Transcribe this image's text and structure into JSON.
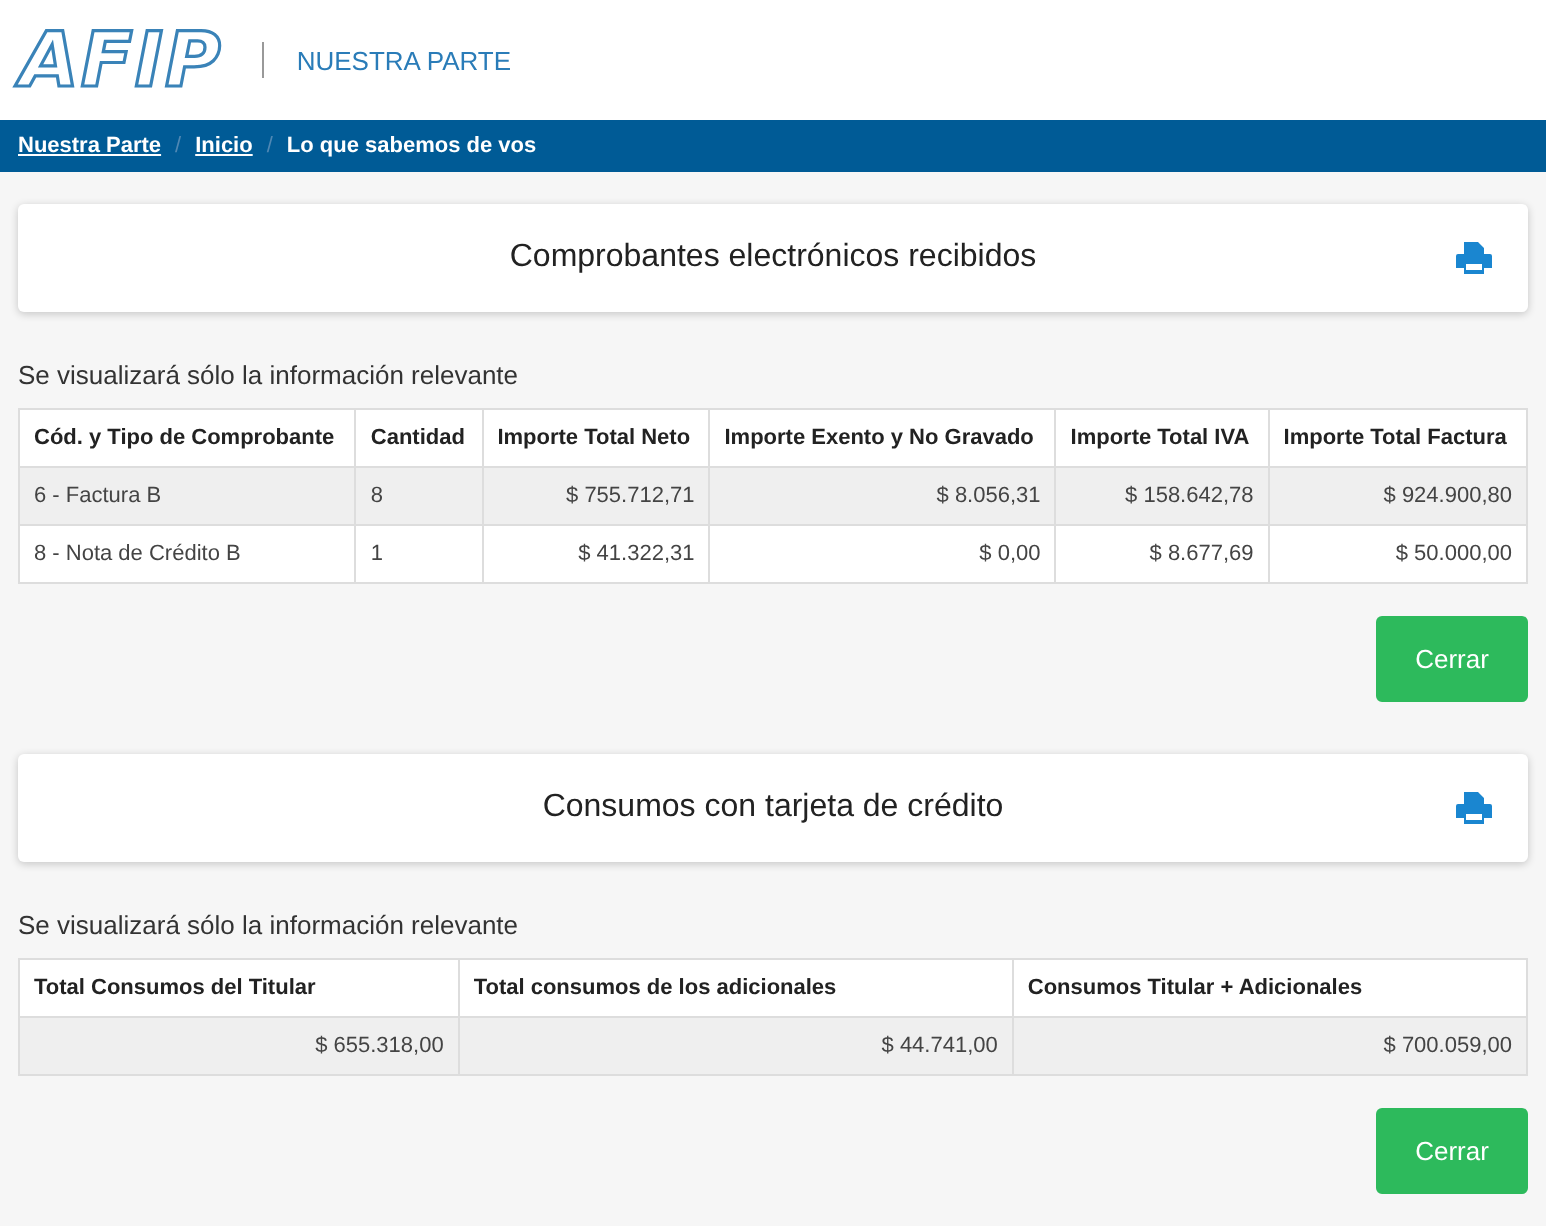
{
  "header": {
    "logo": "AFIP",
    "title": "NUESTRA PARTE"
  },
  "breadcrumb_separator": "/",
  "breadcrumb": [
    {
      "label": "Nuestra Parte",
      "link": true
    },
    {
      "label": "Inicio",
      "link": true
    },
    {
      "label": "Lo que sabemos de vos",
      "link": false
    }
  ],
  "sections": [
    {
      "title": "Comprobantes electrónicos recibidos",
      "note": "Se visualizará sólo la información relevante",
      "columns": [
        {
          "label": "Cód. y Tipo de Comprobante",
          "kind": "text"
        },
        {
          "label": "Cantidad",
          "kind": "text"
        },
        {
          "label": "Importe Total Neto",
          "kind": "amount"
        },
        {
          "label": "Importe Exento y No Gravado",
          "kind": "amount"
        },
        {
          "label": "Importe Total IVA",
          "kind": "amount"
        },
        {
          "label": "Importe Total Factura",
          "kind": "amount"
        }
      ],
      "rows": [
        [
          "6 - Factura B",
          "8",
          "$ 755.712,71",
          "$ 8.056,31",
          "$ 158.642,78",
          "$ 924.900,80"
        ],
        [
          "8 - Nota de Crédito B",
          "1",
          "$ 41.322,31",
          "$ 0,00",
          "$ 8.677,69",
          "$ 50.000,00"
        ]
      ],
      "button": "Cerrar"
    },
    {
      "title": "Consumos con tarjeta de crédito",
      "note": "Se visualizará sólo la información relevante",
      "columns": [
        {
          "label": "Total Consumos del Titular",
          "kind": "amount"
        },
        {
          "label": "Total consumos de los adicionales",
          "kind": "amount"
        },
        {
          "label": "Consumos Titular + Adicionales",
          "kind": "amount"
        }
      ],
      "rows": [
        [
          "$ 655.318,00",
          "$ 44.741,00",
          "$ 700.059,00"
        ]
      ],
      "button": "Cerrar"
    }
  ]
}
